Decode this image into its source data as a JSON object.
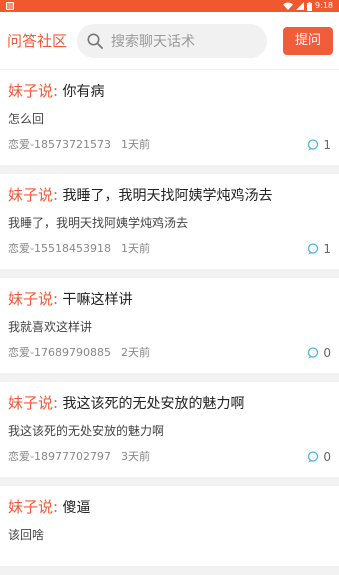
{
  "status_bar": {
    "time": "9:18"
  },
  "header": {
    "title": "问答社区",
    "search_placeholder": "搜索聊天话术",
    "ask_label": "提问"
  },
  "posts": [
    {
      "prefix": "妹子说:",
      "title": "你有病",
      "body": "怎么回",
      "author": "恋爱-18573721573",
      "time": "1天前",
      "replies": "1"
    },
    {
      "prefix": "妹子说:",
      "title": "我睡了，我明天找阿姨学炖鸡汤去",
      "body": "我睡了，我明天找阿姨学炖鸡汤去",
      "author": "恋爱-15518453918",
      "time": "1天前",
      "replies": "1"
    },
    {
      "prefix": "妹子说:",
      "title": "干嘛这样讲",
      "body": "我就喜欢这样讲",
      "author": "恋爱-17689790885",
      "time": "2天前",
      "replies": "0"
    },
    {
      "prefix": "妹子说:",
      "title": "我这该死的无处安放的魅力啊",
      "body": "我这该死的无处安放的魅力啊",
      "author": "恋爱-18977702797",
      "time": "3天前",
      "replies": "0"
    },
    {
      "prefix": "妹子说:",
      "title": "傻逼",
      "body": "该回啥"
    }
  ],
  "colors": {
    "accent": "#f05a3a",
    "reply_icon": "#4fb6d8"
  },
  "icons": [
    "notification-icon",
    "wifi-icon",
    "signal-icon",
    "battery-icon",
    "search-icon",
    "comment-icon"
  ]
}
